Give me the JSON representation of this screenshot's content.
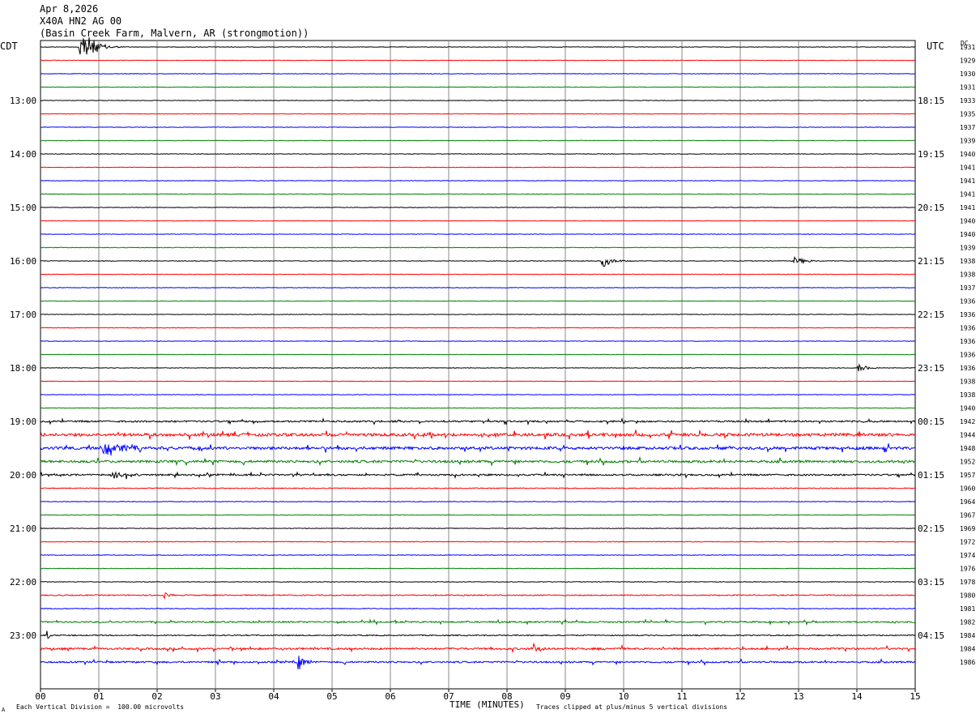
{
  "header": {
    "date": "Apr 8,2026",
    "station": "X40A HN2 AG 00",
    "site": "(Basin Creek Farm, Malvern, AR (strongmotion))",
    "left_tz": "CDT",
    "right_tz": "UTC",
    "dc_label": "DC"
  },
  "footer": {
    "scale_note": "Each Vertical Division =  100.00 microvolts",
    "xlabel": "TIME (MINUTES)",
    "clip_note": "Traces clipped at plus/minus 5 vertical divisions",
    "corner_mark": "A"
  },
  "chart_data": {
    "type": "line",
    "subtype": "helicorder",
    "xlabel": "TIME (MINUTES)",
    "x_ticks": [
      "00",
      "01",
      "02",
      "03",
      "04",
      "05",
      "06",
      "07",
      "08",
      "09",
      "10",
      "11",
      "12",
      "13",
      "14",
      "15"
    ],
    "xlim": [
      0,
      15
    ],
    "grid": true,
    "trace_colors": [
      "#000000",
      "#ff0000",
      "#0000ff",
      "#008000"
    ],
    "left_hour_labels": [
      "13:00",
      "14:00",
      "15:00",
      "16:00",
      "17:00",
      "18:00",
      "19:00",
      "20:00",
      "21:00",
      "22:00",
      "23:00"
    ],
    "right_hour_labels": [
      "18:15",
      "19:15",
      "20:15",
      "21:15",
      "22:15",
      "23:15",
      "00:15",
      "01:15",
      "02:15",
      "03:15",
      "04:15"
    ],
    "dc_offsets": [
      "1931",
      "1929",
      "1930",
      "1931",
      "1933",
      "1935",
      "1937",
      "1939",
      "1940",
      "1941",
      "1941",
      "1941",
      "1941",
      "1940",
      "1940",
      "1939",
      "1938",
      "1938",
      "1937",
      "1936",
      "1936",
      "1936",
      "1936",
      "1936",
      "1936",
      "1938",
      "1938",
      "1940",
      "1942",
      "1944",
      "1948",
      "1952",
      "1957",
      "1960",
      "1964",
      "1967",
      "1969",
      "1972",
      "1974",
      "1976",
      "1978",
      "1980",
      "1981",
      "1982",
      "1984",
      "1984",
      "1986"
    ],
    "activity_levels": [
      0.3,
      0.3,
      0.3,
      0.3,
      0.3,
      0.3,
      0.3,
      0.35,
      0.3,
      0.3,
      0.3,
      0.35,
      0.3,
      0.3,
      0.3,
      0.35,
      0.35,
      0.3,
      0.3,
      0.3,
      0.3,
      0.3,
      0.3,
      0.3,
      0.3,
      0.3,
      0.3,
      0.35,
      0.9,
      1.6,
      1.5,
      1.3,
      0.9,
      0.5,
      0.35,
      0.35,
      0.35,
      0.4,
      0.35,
      0.3,
      0.35,
      0.6,
      0.4,
      0.8,
      0.6,
      1.0,
      0.9
    ],
    "events": [
      {
        "trace": 0,
        "start_min": 0.65,
        "end_min": 1.4,
        "amplitude_div": 5
      },
      {
        "trace": 16,
        "start_min": 9.6,
        "end_min": 10.2,
        "amplitude_div": 1.6
      },
      {
        "trace": 16,
        "start_min": 12.9,
        "end_min": 13.6,
        "amplitude_div": 0.9
      },
      {
        "trace": 24,
        "start_min": 14.0,
        "end_min": 14.6,
        "amplitude_div": 0.9
      },
      {
        "trace": 30,
        "start_min": 1.0,
        "end_min": 2.6,
        "amplitude_div": 1.6
      },
      {
        "trace": 32,
        "start_min": 1.2,
        "end_min": 1.9,
        "amplitude_div": 1.4
      },
      {
        "trace": 41,
        "start_min": 2.1,
        "end_min": 2.4,
        "amplitude_div": 1.0
      },
      {
        "trace": 44,
        "start_min": 0.1,
        "end_min": 0.2,
        "amplitude_div": 2.5
      },
      {
        "trace": 45,
        "start_min": 8.4,
        "end_min": 8.9,
        "amplitude_div": 1.2
      },
      {
        "trace": 46,
        "start_min": 4.4,
        "end_min": 4.8,
        "amplitude_div": 2.0
      }
    ]
  }
}
